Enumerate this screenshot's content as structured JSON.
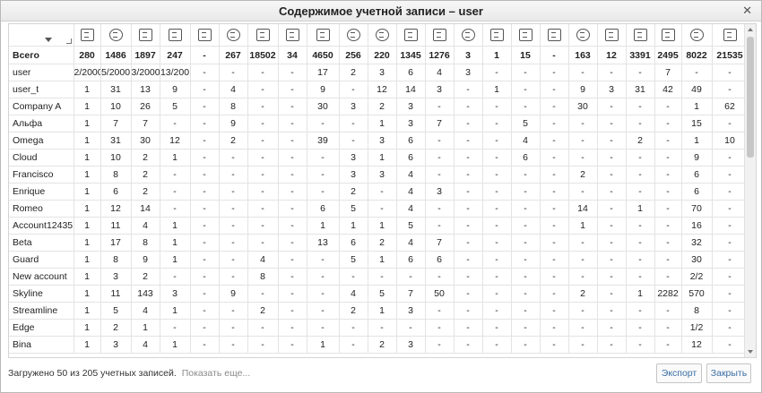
{
  "window": {
    "title": "Содержимое учетной записи – user"
  },
  "table": {
    "column_icons": [
      "units-icon",
      "users-icon",
      "bus-icon",
      "unit-groups-icon",
      "retranslator-icon",
      "geofence-icon",
      "calendar-icon",
      "table-icon",
      "routes-icon",
      "jobs-icon",
      "alarm-icon",
      "tasks-icon",
      "steering-wheel-icon",
      "vehicle-icon",
      "driver-icon",
      "trailer-icon",
      "truck-icon",
      "reports-icon",
      "report-templates-icon",
      "media-icon",
      "tools-icon",
      "monitor-icon",
      "sms-icon"
    ],
    "total_label": "Всего",
    "totals": [
      "280",
      "1486",
      "1897",
      "247",
      "-",
      "267",
      "18502",
      "34",
      "4650",
      "256",
      "220",
      "1345",
      "1276",
      "3",
      "1",
      "15",
      "-",
      "163",
      "12",
      "3391",
      "2495",
      "8022",
      "21535"
    ],
    "rows": [
      {
        "name": "user",
        "cells": [
          "2/2000",
          "5/2000",
          "3/2000",
          "13/200",
          "-",
          "-",
          "-",
          "-",
          "17",
          "2",
          "3",
          "6",
          "4",
          "3",
          "-",
          "-",
          "-",
          "-",
          "-",
          "-",
          "7",
          "-",
          "-"
        ]
      },
      {
        "name": "user_t",
        "cells": [
          "1",
          "31",
          "13",
          "9",
          "-",
          "4",
          "-",
          "-",
          "9",
          "-",
          "12",
          "14",
          "3",
          "-",
          "1",
          "-",
          "-",
          "9",
          "3",
          "31",
          "42",
          "49",
          "-"
        ]
      },
      {
        "name": "Company A",
        "cells": [
          "1",
          "10",
          "26",
          "5",
          "-",
          "8",
          "-",
          "-",
          "30",
          "3",
          "2",
          "3",
          "-",
          "-",
          "-",
          "-",
          "-",
          "30",
          "-",
          "-",
          "-",
          "1",
          "62"
        ]
      },
      {
        "name": "Альфа",
        "cells": [
          "1",
          "7",
          "7",
          "-",
          "-",
          "9",
          "-",
          "-",
          "-",
          "-",
          "1",
          "3",
          "7",
          "-",
          "-",
          "5",
          "-",
          "-",
          "-",
          "-",
          "-",
          "15",
          "-"
        ]
      },
      {
        "name": "Omega",
        "cells": [
          "1",
          "31",
          "30",
          "12",
          "-",
          "2",
          "-",
          "-",
          "39",
          "-",
          "3",
          "6",
          "-",
          "-",
          "-",
          "4",
          "-",
          "-",
          "-",
          "2",
          "-",
          "1",
          "10"
        ]
      },
      {
        "name": "Cloud",
        "cells": [
          "1",
          "10",
          "2",
          "1",
          "-",
          "-",
          "-",
          "-",
          "-",
          "3",
          "1",
          "6",
          "-",
          "-",
          "-",
          "6",
          "-",
          "-",
          "-",
          "-",
          "-",
          "9",
          "-"
        ]
      },
      {
        "name": "Francisco",
        "cells": [
          "1",
          "8",
          "2",
          "-",
          "-",
          "-",
          "-",
          "-",
          "-",
          "3",
          "3",
          "4",
          "-",
          "-",
          "-",
          "-",
          "-",
          "2",
          "-",
          "-",
          "-",
          "6",
          "-"
        ]
      },
      {
        "name": "Enrique",
        "cells": [
          "1",
          "6",
          "2",
          "-",
          "-",
          "-",
          "-",
          "-",
          "-",
          "2",
          "-",
          "4",
          "3",
          "-",
          "-",
          "-",
          "-",
          "-",
          "-",
          "-",
          "-",
          "6",
          "-"
        ]
      },
      {
        "name": "Romeo",
        "cells": [
          "1",
          "12",
          "14",
          "-",
          "-",
          "-",
          "-",
          "-",
          "6",
          "5",
          "-",
          "4",
          "-",
          "-",
          "-",
          "-",
          "-",
          "14",
          "-",
          "1",
          "-",
          "70",
          "-"
        ]
      },
      {
        "name": "Account12435",
        "cells": [
          "1",
          "11",
          "4",
          "1",
          "-",
          "-",
          "-",
          "-",
          "1",
          "1",
          "1",
          "5",
          "-",
          "-",
          "-",
          "-",
          "-",
          "1",
          "-",
          "-",
          "-",
          "16",
          "-"
        ]
      },
      {
        "name": "Beta",
        "cells": [
          "1",
          "17",
          "8",
          "1",
          "-",
          "-",
          "-",
          "-",
          "13",
          "6",
          "2",
          "4",
          "7",
          "-",
          "-",
          "-",
          "-",
          "-",
          "-",
          "-",
          "-",
          "32",
          "-"
        ]
      },
      {
        "name": "Guard",
        "cells": [
          "1",
          "8",
          "9",
          "1",
          "-",
          "-",
          "4",
          "-",
          "-",
          "5",
          "1",
          "6",
          "6",
          "-",
          "-",
          "-",
          "-",
          "-",
          "-",
          "-",
          "-",
          "30",
          "-"
        ]
      },
      {
        "name": "New account",
        "cells": [
          "1",
          "3",
          "2",
          "-",
          "-",
          "-",
          "8",
          "-",
          "-",
          "-",
          "-",
          "-",
          "-",
          "-",
          "-",
          "-",
          "-",
          "-",
          "-",
          "-",
          "-",
          "2/2",
          "-"
        ]
      },
      {
        "name": "Skyline",
        "cells": [
          "1",
          "11",
          "143",
          "3",
          "-",
          "9",
          "-",
          "-",
          "-",
          "4",
          "5",
          "7",
          "50",
          "-",
          "-",
          "-",
          "-",
          "2",
          "-",
          "1",
          "2282",
          "570",
          "-"
        ]
      },
      {
        "name": "Streamline",
        "cells": [
          "1",
          "5",
          "4",
          "1",
          "-",
          "-",
          "2",
          "-",
          "-",
          "2",
          "1",
          "3",
          "-",
          "-",
          "-",
          "-",
          "-",
          "-",
          "-",
          "-",
          "-",
          "8",
          "-"
        ]
      },
      {
        "name": "Edge",
        "cells": [
          "1",
          "2",
          "1",
          "-",
          "-",
          "-",
          "-",
          "-",
          "-",
          "-",
          "-",
          "-",
          "-",
          "-",
          "-",
          "-",
          "-",
          "-",
          "-",
          "-",
          "-",
          "1/2",
          "-"
        ]
      },
      {
        "name": "Bina",
        "cells": [
          "1",
          "3",
          "4",
          "1",
          "-",
          "-",
          "-",
          "-",
          "1",
          "-",
          "2",
          "3",
          "-",
          "-",
          "-",
          "-",
          "-",
          "-",
          "-",
          "-",
          "-",
          "12",
          "-"
        ]
      }
    ]
  },
  "footer": {
    "status": "Загружено 50 из 205 учетных записей.",
    "show_more": "Показать еще...",
    "export_label": "Экспорт",
    "close_label": "Закрыть"
  }
}
